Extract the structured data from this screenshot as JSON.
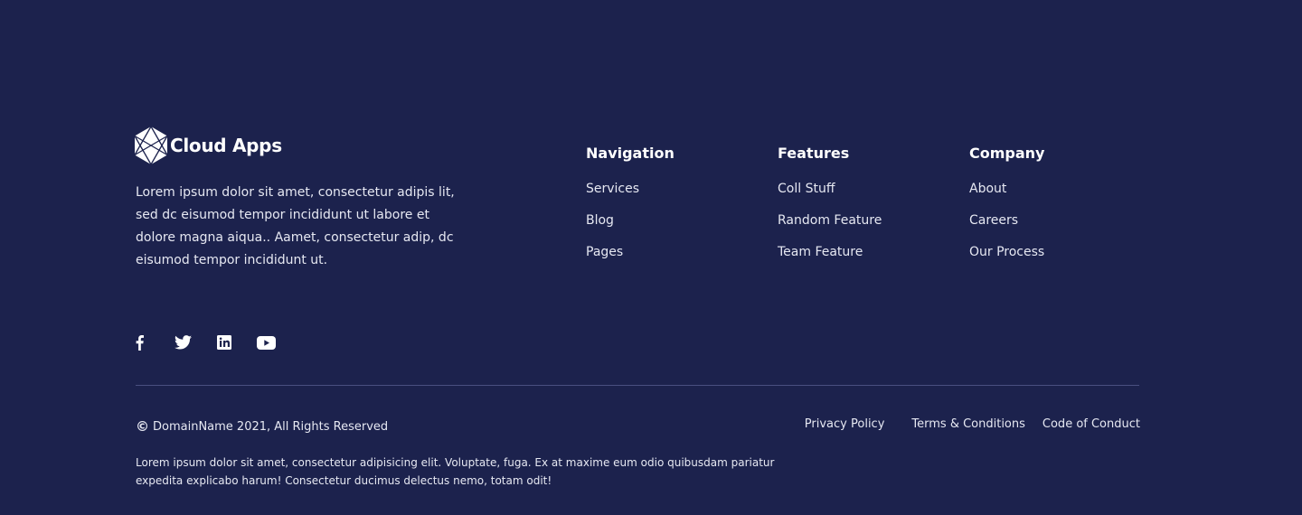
{
  "brand": {
    "name": "Cloud Apps",
    "logo_icon": "hexagon-logo-icon",
    "description": "Lorem ipsum dolor sit amet, consectetur adipis lit, sed dc eisumod tempor incididunt ut labore et dolore magna aiqua.. Aamet, consectetur adip, dc eisumod tempor incididunt ut."
  },
  "columns": {
    "navigation": {
      "title": "Navigation",
      "links": [
        "Services",
        "Blog",
        "Pages"
      ]
    },
    "features": {
      "title": "Features",
      "links": [
        "Coll Stuff",
        "Random Feature",
        "Team Feature"
      ]
    },
    "company": {
      "title": "Company",
      "links": [
        "About",
        "Careers",
        "Our Process"
      ]
    }
  },
  "social": {
    "icons": [
      "facebook-icon",
      "twitter-icon",
      "linkedin-icon",
      "youtube-icon"
    ]
  },
  "bottom": {
    "copyright_symbol": "©",
    "copyright": "DomainName 2021, All Rights Reserved",
    "legal_links": [
      "Privacy Policy",
      "Terms & Conditions",
      "Code of Conduct"
    ],
    "fine_print": "Lorem ipsum dolor sit amet, consectetur adipisicing elit. Voluptate, fuga. Ex at maxime eum odio quibusdam pariatur expedita explicabo harum! Consectetur ducimus delectus nemo, totam odit!"
  },
  "colors": {
    "background": "#1c224d",
    "text": "#ffffff",
    "muted_text": "#e6e8f2",
    "divider": "#4a5080"
  }
}
